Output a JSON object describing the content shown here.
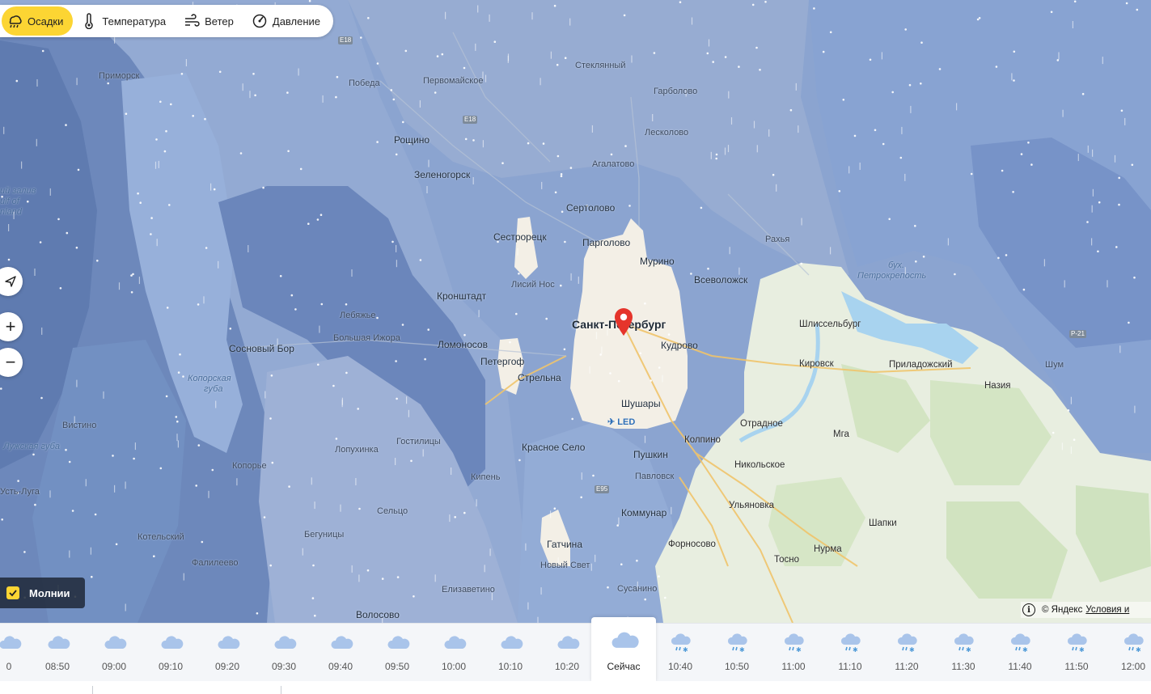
{
  "layers": [
    {
      "label": "Осадки",
      "icon": "rain-cloud-icon",
      "active": true
    },
    {
      "label": "Температура",
      "icon": "thermometer-icon",
      "active": false
    },
    {
      "label": "Ветер",
      "icon": "wind-icon",
      "active": false
    },
    {
      "label": "Давление",
      "icon": "pressure-gauge-icon",
      "active": false
    }
  ],
  "map": {
    "city": "Санкт-Петербург",
    "places": [
      "Приморск",
      "Победа",
      "Первомайское",
      "Стеклянный",
      "Гарболово",
      "Рощино",
      "Лесколово",
      "Агалатово",
      "Зеленогорск",
      "Сертолово",
      "Сестрорецк",
      "Парголово",
      "Мурино",
      "Рахья",
      "Всеволожск",
      "Лисий Нос",
      "Кронштадт",
      "Лебяжье",
      "Большая Ижора",
      "Сосновый Бор",
      "Ломоносов",
      "Петергоф",
      "Стрельна",
      "Кудрово",
      "Шлиссельбург",
      "Кировск",
      "Приладожский",
      "Назия",
      "Шум",
      "Шушары",
      "Отрадное",
      "Колпино",
      "Мга",
      "Вистино",
      "Гостилицы",
      "Лопухинка",
      "Копорье",
      "Кипень",
      "Красное Село",
      "Пушкин",
      "Никольское",
      "Павловск",
      "Сельцо",
      "Коммунар",
      "Ульяновка",
      "Шапки",
      "Котельский",
      "Бегуницы",
      "Гатчина",
      "Форносово",
      "Нурма",
      "Тосно",
      "Фалилеево",
      "Новый Свет",
      "Сусанино",
      "Елизаветино",
      "Волосово",
      "Усть-Луга",
      "Мурино"
    ],
    "water_labels": [
      "Финский залив",
      "Gulf of Finland",
      "Копорская губа",
      "Лужская губа",
      "бух. Петрокрепость"
    ],
    "roads": [
      "E18",
      "E18",
      "E95",
      "Р-21"
    ],
    "airport": "LED"
  },
  "controls": {
    "locate": "location-arrow-icon",
    "zoom_in": "+",
    "zoom_out": "−"
  },
  "lightning": {
    "label": "Молнии",
    "checked": true
  },
  "attribution": {
    "copyright": "© Яндекс",
    "terms": "Условия и"
  },
  "timeline": [
    {
      "time": "0",
      "icon": "cloud-icon"
    },
    {
      "time": "08:50",
      "icon": "cloud-icon"
    },
    {
      "time": "09:00",
      "icon": "cloud-icon"
    },
    {
      "time": "09:10",
      "icon": "cloud-icon"
    },
    {
      "time": "09:20",
      "icon": "cloud-icon"
    },
    {
      "time": "09:30",
      "icon": "cloud-icon"
    },
    {
      "time": "09:40",
      "icon": "cloud-icon"
    },
    {
      "time": "09:50",
      "icon": "cloud-icon"
    },
    {
      "time": "10:00",
      "icon": "cloud-icon"
    },
    {
      "time": "10:10",
      "icon": "cloud-icon"
    },
    {
      "time": "10:20",
      "icon": "cloud-icon"
    },
    {
      "time": "Сейчас",
      "icon": "cloud-icon",
      "current": true
    },
    {
      "time": "10:40",
      "icon": "snow-rain-icon"
    },
    {
      "time": "10:50",
      "icon": "snow-rain-icon"
    },
    {
      "time": "11:00",
      "icon": "snow-rain-icon"
    },
    {
      "time": "11:10",
      "icon": "snow-rain-icon"
    },
    {
      "time": "11:20",
      "icon": "snow-rain-icon"
    },
    {
      "time": "11:30",
      "icon": "snow-rain-icon"
    },
    {
      "time": "11:40",
      "icon": "snow-rain-icon"
    },
    {
      "time": "11:50",
      "icon": "snow-rain-icon"
    },
    {
      "time": "12:00",
      "icon": "snow-rain-icon"
    }
  ],
  "colors": {
    "accent": "#fcd533",
    "heavy": "#6c87b8",
    "medium": "#8aa6d4",
    "light": "#a9b8d8",
    "land": "#e9efe0",
    "pin": "#e5342b"
  }
}
